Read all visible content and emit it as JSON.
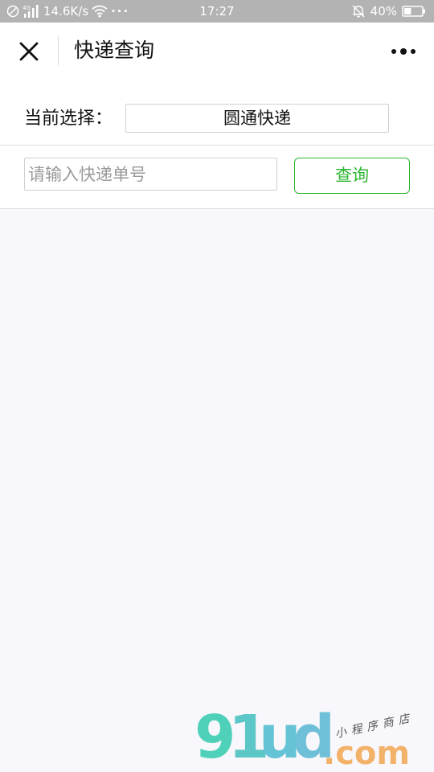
{
  "status_bar": {
    "network_speed": "14.6K/s",
    "more": "···",
    "time": "17:27",
    "battery_percent": "40%",
    "battery_level": 0.4,
    "icons": [
      "blocked-icon",
      "4g-signal-icon",
      "wifi-icon",
      "mute-bell-icon",
      "battery-icon"
    ]
  },
  "nav": {
    "title": "快递查询",
    "close_icon": "close-icon",
    "more_icon": "more-dots-icon"
  },
  "selection": {
    "label": "当前选择：",
    "value": "圆通快递"
  },
  "tracking": {
    "input_value": "",
    "placeholder": "请输入快递单号",
    "button_label": "查询"
  },
  "colors": {
    "accent_green": "#2bb52e",
    "status_bar_bg": "#b3b3b3",
    "page_bg": "#f8f7fb"
  },
  "watermark": {
    "logo_text": "91ud.com",
    "logo_subtext": "小程序商店"
  }
}
